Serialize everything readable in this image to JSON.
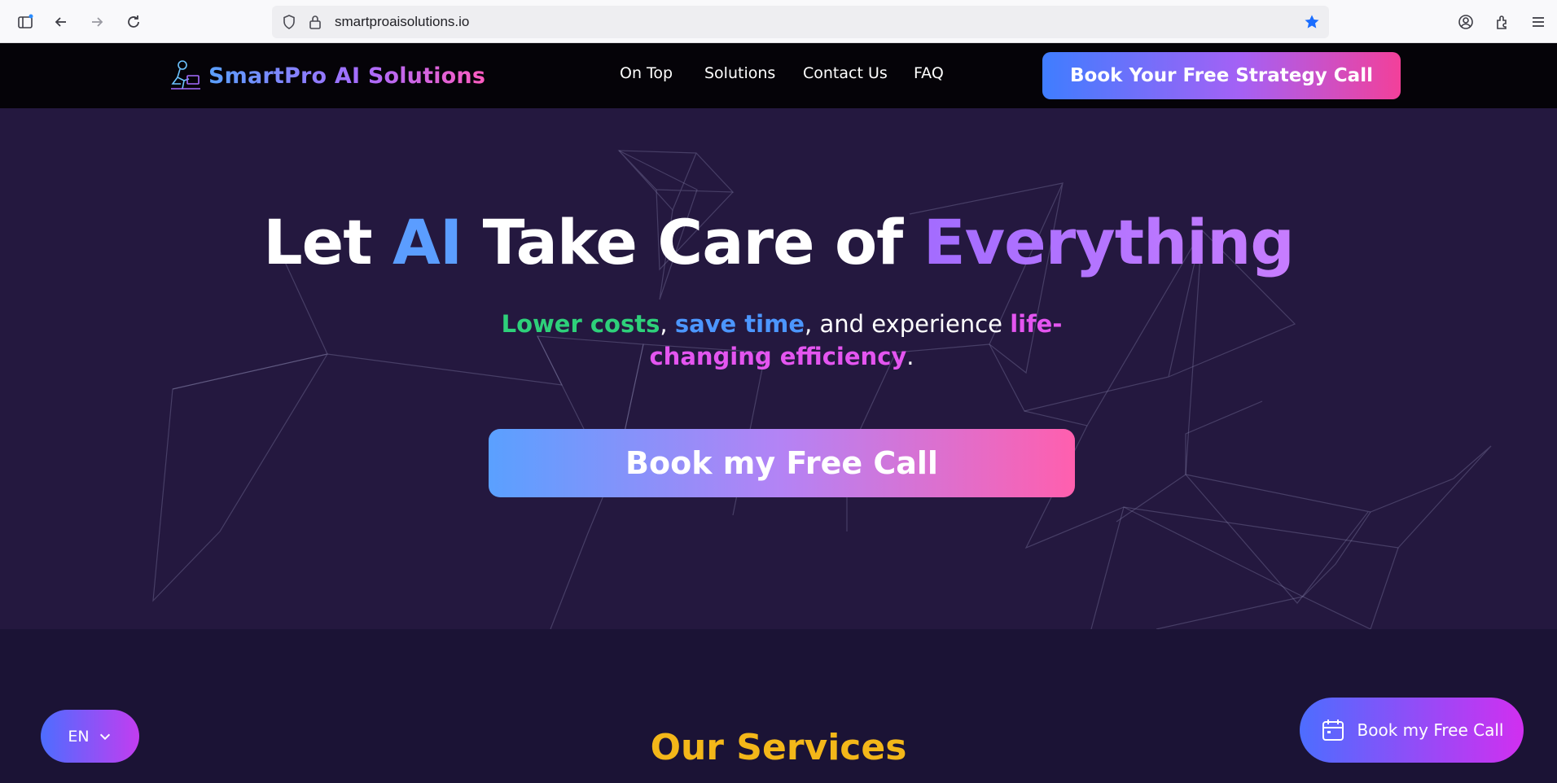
{
  "browser": {
    "url": "smartproaisolutions.io"
  },
  "header": {
    "brand": "SmartPro AI Solutions",
    "nav": [
      "On Top",
      "Solutions",
      "Contact Us",
      "FAQ"
    ],
    "cta": "Book Your Free Strategy Call"
  },
  "hero": {
    "title_part1": "Let ",
    "title_ai": "AI",
    "title_part2": " Take Care of ",
    "title_everything": "Everything",
    "sub_lower_costs": "Lower costs",
    "sub_comma1": ", ",
    "sub_save_time": "save time",
    "sub_mid": ", and experience ",
    "sub_life": "life-changing efficiency",
    "sub_end": ".",
    "cta": "Book my Free Call"
  },
  "services": {
    "title": "Our Services"
  },
  "widgets": {
    "language": "EN",
    "floating_cta": "Book my Free Call"
  },
  "colors": {
    "hero_bg": "#24183f",
    "header_bg": "#050308",
    "services_title": "#f3b719",
    "green": "#2ed07a",
    "blue": "#4c96ff",
    "pink": "#e455f0"
  }
}
